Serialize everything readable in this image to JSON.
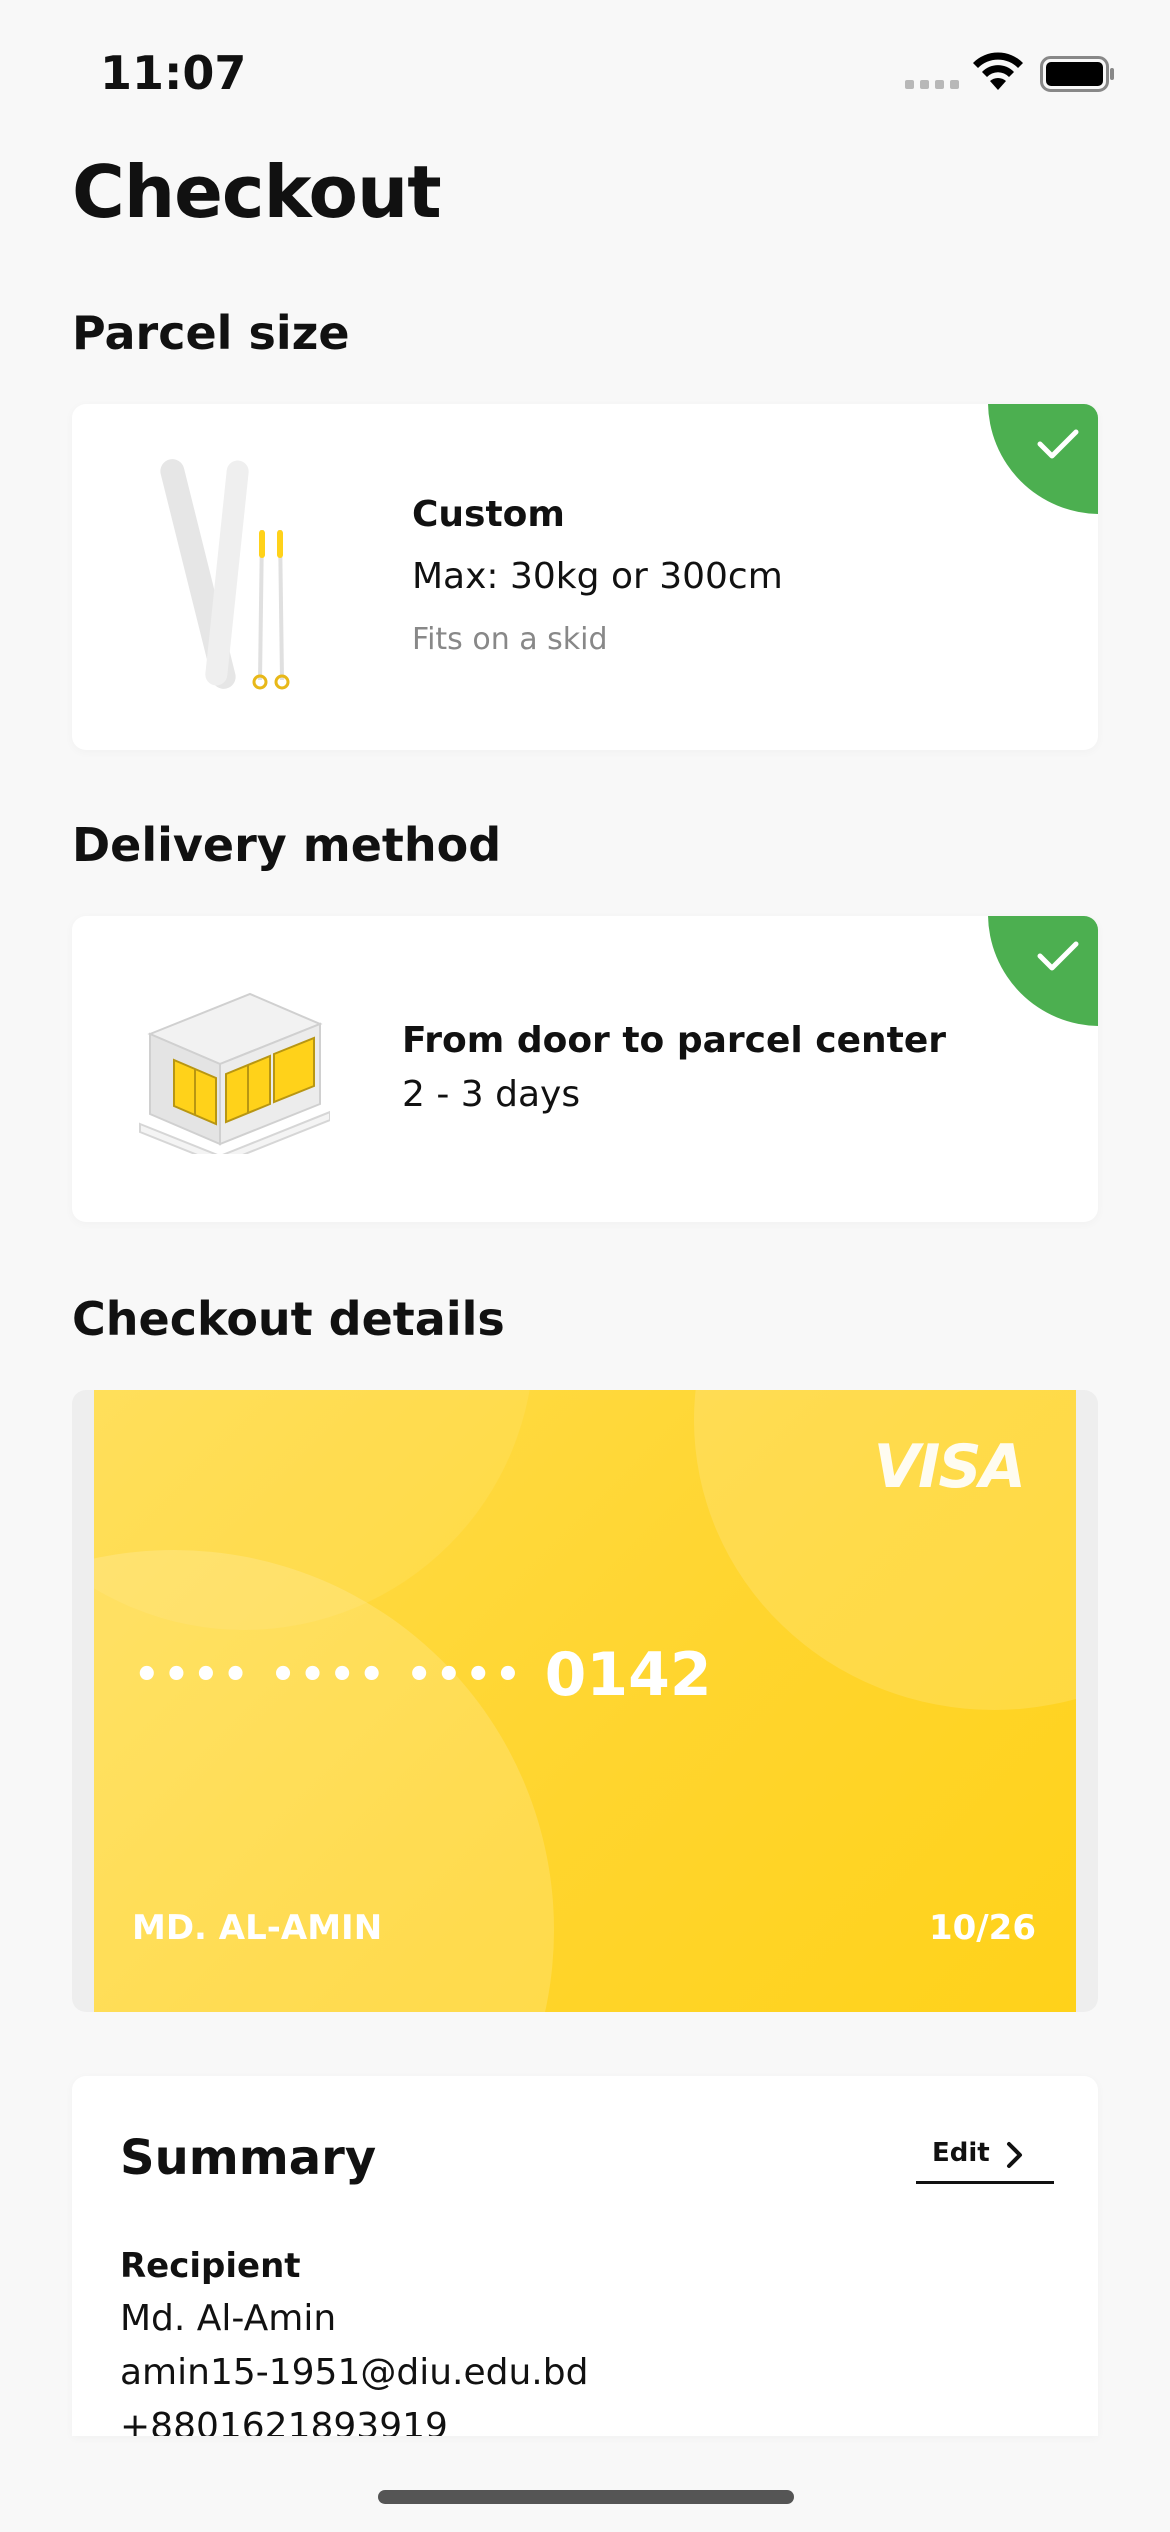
{
  "status_bar": {
    "time": "11:07"
  },
  "page": {
    "title": "Checkout"
  },
  "parcel_section": {
    "title": "Parcel size",
    "name": "Custom",
    "max": "Max: 30kg or 300cm",
    "note": "Fits on a skid"
  },
  "delivery_section": {
    "title": "Delivery method",
    "name": "From door to parcel center",
    "duration": "2 - 3 days"
  },
  "checkout_section": {
    "title": "Checkout details",
    "card": {
      "brand": "VISA",
      "masked_digits": "•••• •••• ••••",
      "last4": "0142",
      "holder": "MD. AL-AMIN",
      "expiry": "10/26"
    }
  },
  "summary": {
    "title": "Summary",
    "edit_label": "Edit",
    "recipient_label": "Recipient",
    "recipient_name": "Md. Al-Amin",
    "recipient_email": "amin15-1951@diu.edu.bd",
    "recipient_phone": "+8801621893919"
  },
  "colors": {
    "accent_yellow": "#ffd52e",
    "check_green": "#4caf50",
    "background": "#f8f8f8"
  },
  "icons": [
    "wifi-icon",
    "battery-icon",
    "check-icon",
    "chevron-right-icon",
    "skis-image",
    "parcel-locker-image"
  ]
}
